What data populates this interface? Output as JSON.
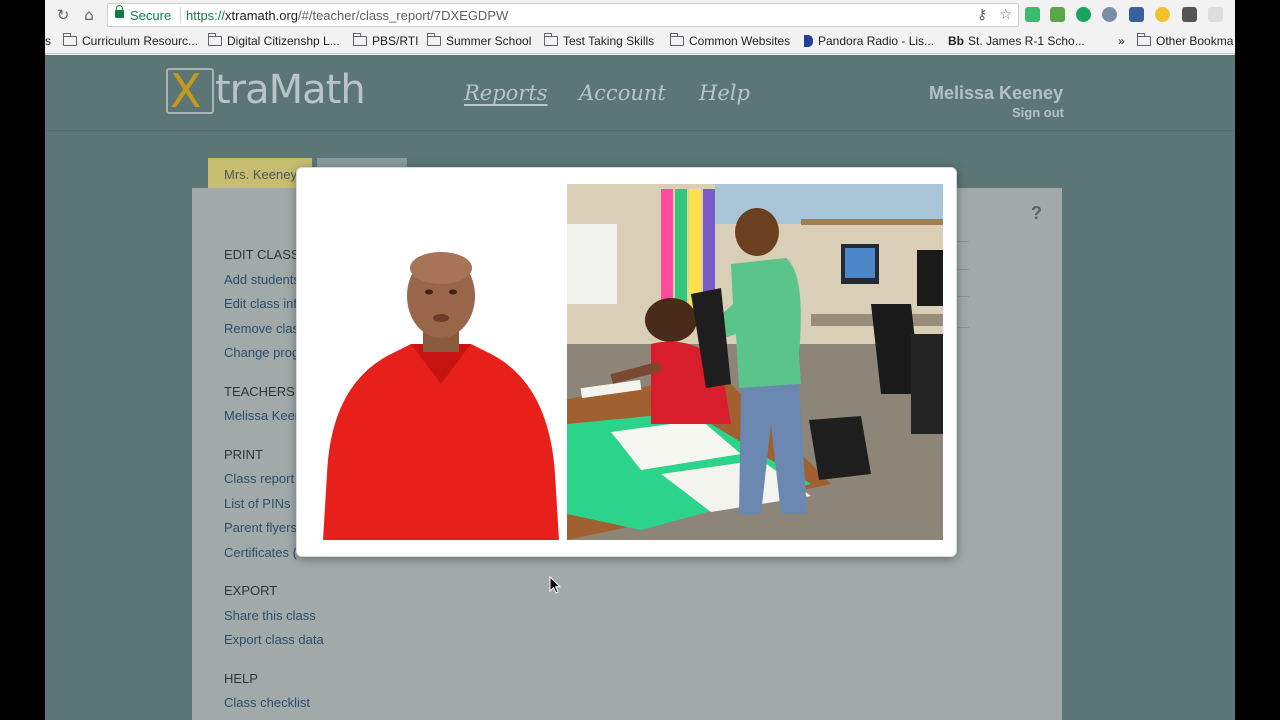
{
  "browser": {
    "secure_label": "Secure",
    "url_scheme": "https://",
    "url_host": "xtramath.org",
    "url_path": "/#/teacher/class_report/7DXEGDPW",
    "icons": [
      "reload-icon",
      "home-icon",
      "key-icon",
      "star-icon"
    ]
  },
  "bookmarks": {
    "leading": "s",
    "items": [
      "Curriculum Resourc...",
      "Digital Citizenshp L...",
      "PBS/RTI",
      "Summer School",
      "Test Taking Skills",
      "Common Websites",
      "Pandora Radio - Lis...",
      "St. James R-1 Scho..."
    ],
    "bb_prefix": "Bb",
    "overflow": "»",
    "other": "Other Bookma"
  },
  "header": {
    "logo_x": "X",
    "logo_rest": "traMath",
    "nav": [
      "Reports",
      "Account",
      "Help"
    ],
    "user_name": "Melissa Keeney",
    "sign_out": "Sign out"
  },
  "tabs": {
    "active": "Mrs. Keeney"
  },
  "panel": {
    "help_symbol": "?",
    "sections": [
      {
        "title": "EDIT CLASS",
        "links": [
          "Add students",
          "Edit class inf",
          "Remove clas",
          "Change prog"
        ]
      },
      {
        "title": "TEACHERS",
        "links": [
          "Melissa Keer"
        ]
      },
      {
        "title": "PRINT",
        "links": [
          "Class report",
          "List of PINs",
          "Parent flyers",
          "Certificates ("
        ]
      },
      {
        "title": "EXPORT",
        "links": [
          "Share this class",
          "Export class data"
        ]
      },
      {
        "title": "HELP",
        "links": [
          "Class checklist"
        ]
      }
    ]
  },
  "colors": {
    "page_bg": "#5c7676",
    "panel_bg": "#a1a9a9",
    "tab_active": "#c7bd70",
    "logo_accent": "#c59a1a",
    "link": "#2b4f6e"
  }
}
